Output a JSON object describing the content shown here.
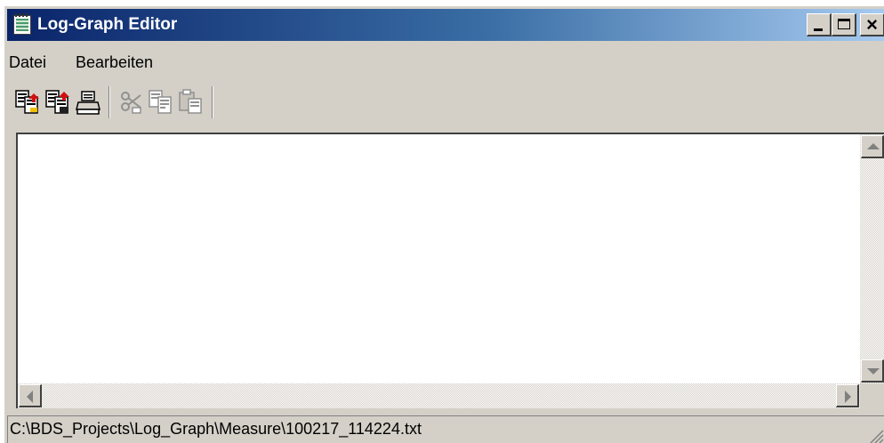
{
  "window": {
    "title": "Log-Graph Editor",
    "controls": {
      "minimize": "minimize",
      "maximize": "maximize",
      "close": "close"
    }
  },
  "menubar": {
    "items": [
      {
        "label": "Datei"
      },
      {
        "label": "Bearbeiten"
      }
    ]
  },
  "toolbar": {
    "buttons": [
      {
        "icon": "open-file-icon",
        "enabled": true
      },
      {
        "icon": "save-file-icon",
        "enabled": true
      },
      {
        "icon": "print-icon",
        "enabled": true
      },
      {
        "icon": "cut-icon",
        "enabled": false
      },
      {
        "icon": "copy-icon",
        "enabled": false
      },
      {
        "icon": "paste-icon",
        "enabled": false
      }
    ]
  },
  "editor": {
    "content": ""
  },
  "statusbar": {
    "path": "C:\\BDS_Projects\\Log_Graph\\Measure\\100217_114224.txt"
  },
  "colors": {
    "titlebar_start": "#0a246a",
    "titlebar_end": "#a6caf0",
    "chrome": "#d4d0c8"
  }
}
